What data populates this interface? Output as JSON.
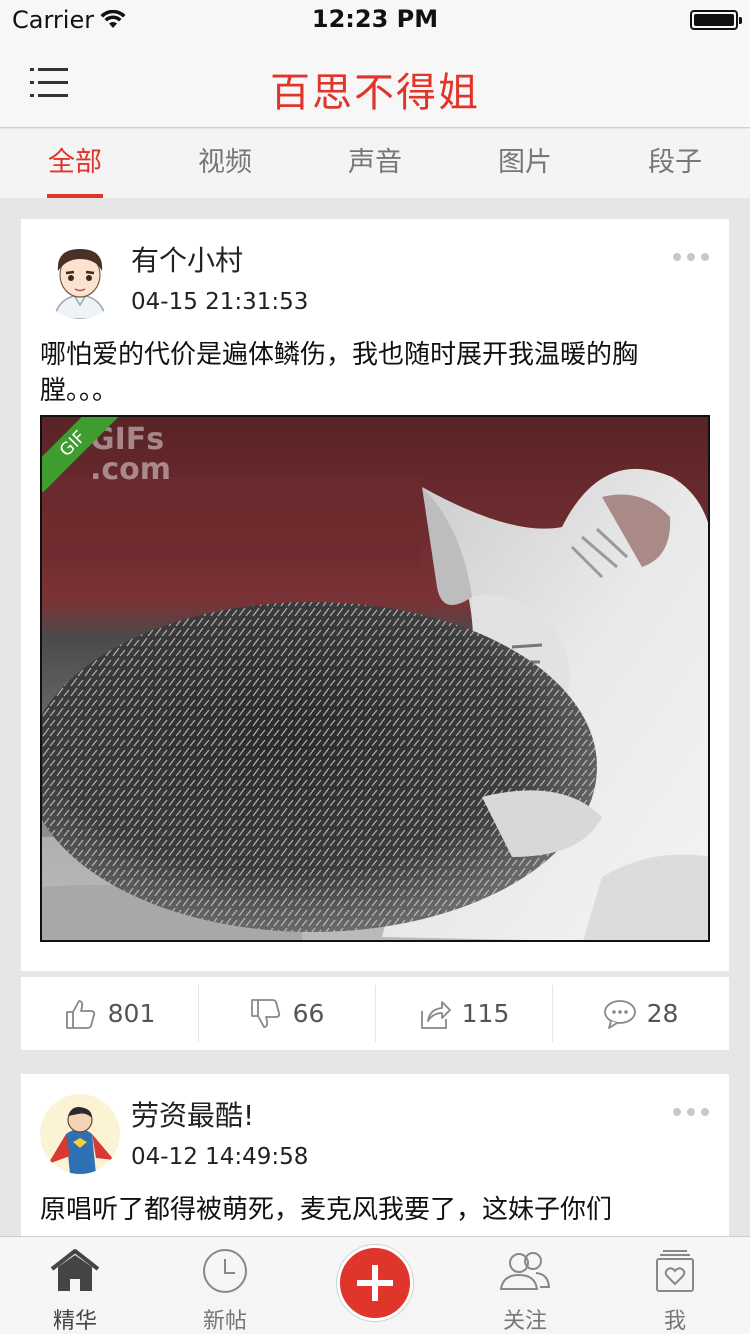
{
  "status_bar": {
    "carrier": "Carrier",
    "time": "12:23 PM",
    "battery": 1.0
  },
  "nav": {
    "title": "百思不得姐",
    "menu_icon": "menu-icon"
  },
  "tabs": [
    {
      "label": "全部",
      "active": true
    },
    {
      "label": "视频",
      "active": false
    },
    {
      "label": "声音",
      "active": false
    },
    {
      "label": "图片",
      "active": false
    },
    {
      "label": "段子",
      "active": false
    }
  ],
  "posts": [
    {
      "username": "有个小村",
      "time": "04-15 21:31:53",
      "text": "哪怕爱的代价是遍体鳞伤，我也随时展开我温暖的胸膛。。。",
      "media": {
        "badge": "GIF",
        "watermark": "GIFs\n.com"
      },
      "actions": {
        "like": "801",
        "dislike": "66",
        "share": "115",
        "comment": "28"
      }
    },
    {
      "username": "劳资最酷!",
      "time": "04-12 14:49:58",
      "text": "原唱听了都得被萌死，麦克风我要了，这妹子你们"
    }
  ],
  "tabbar": [
    {
      "label": "精华",
      "icon": "home-icon",
      "active": true
    },
    {
      "label": "新帖",
      "icon": "clock-icon",
      "active": false
    },
    {
      "label": "",
      "icon": "plus-icon",
      "active": false
    },
    {
      "label": "关注",
      "icon": "people-icon",
      "active": false
    },
    {
      "label": "我",
      "icon": "profile-icon",
      "active": false
    }
  ],
  "colors": {
    "accent": "#e0352b",
    "gif_badge": "#3f9d2f"
  }
}
